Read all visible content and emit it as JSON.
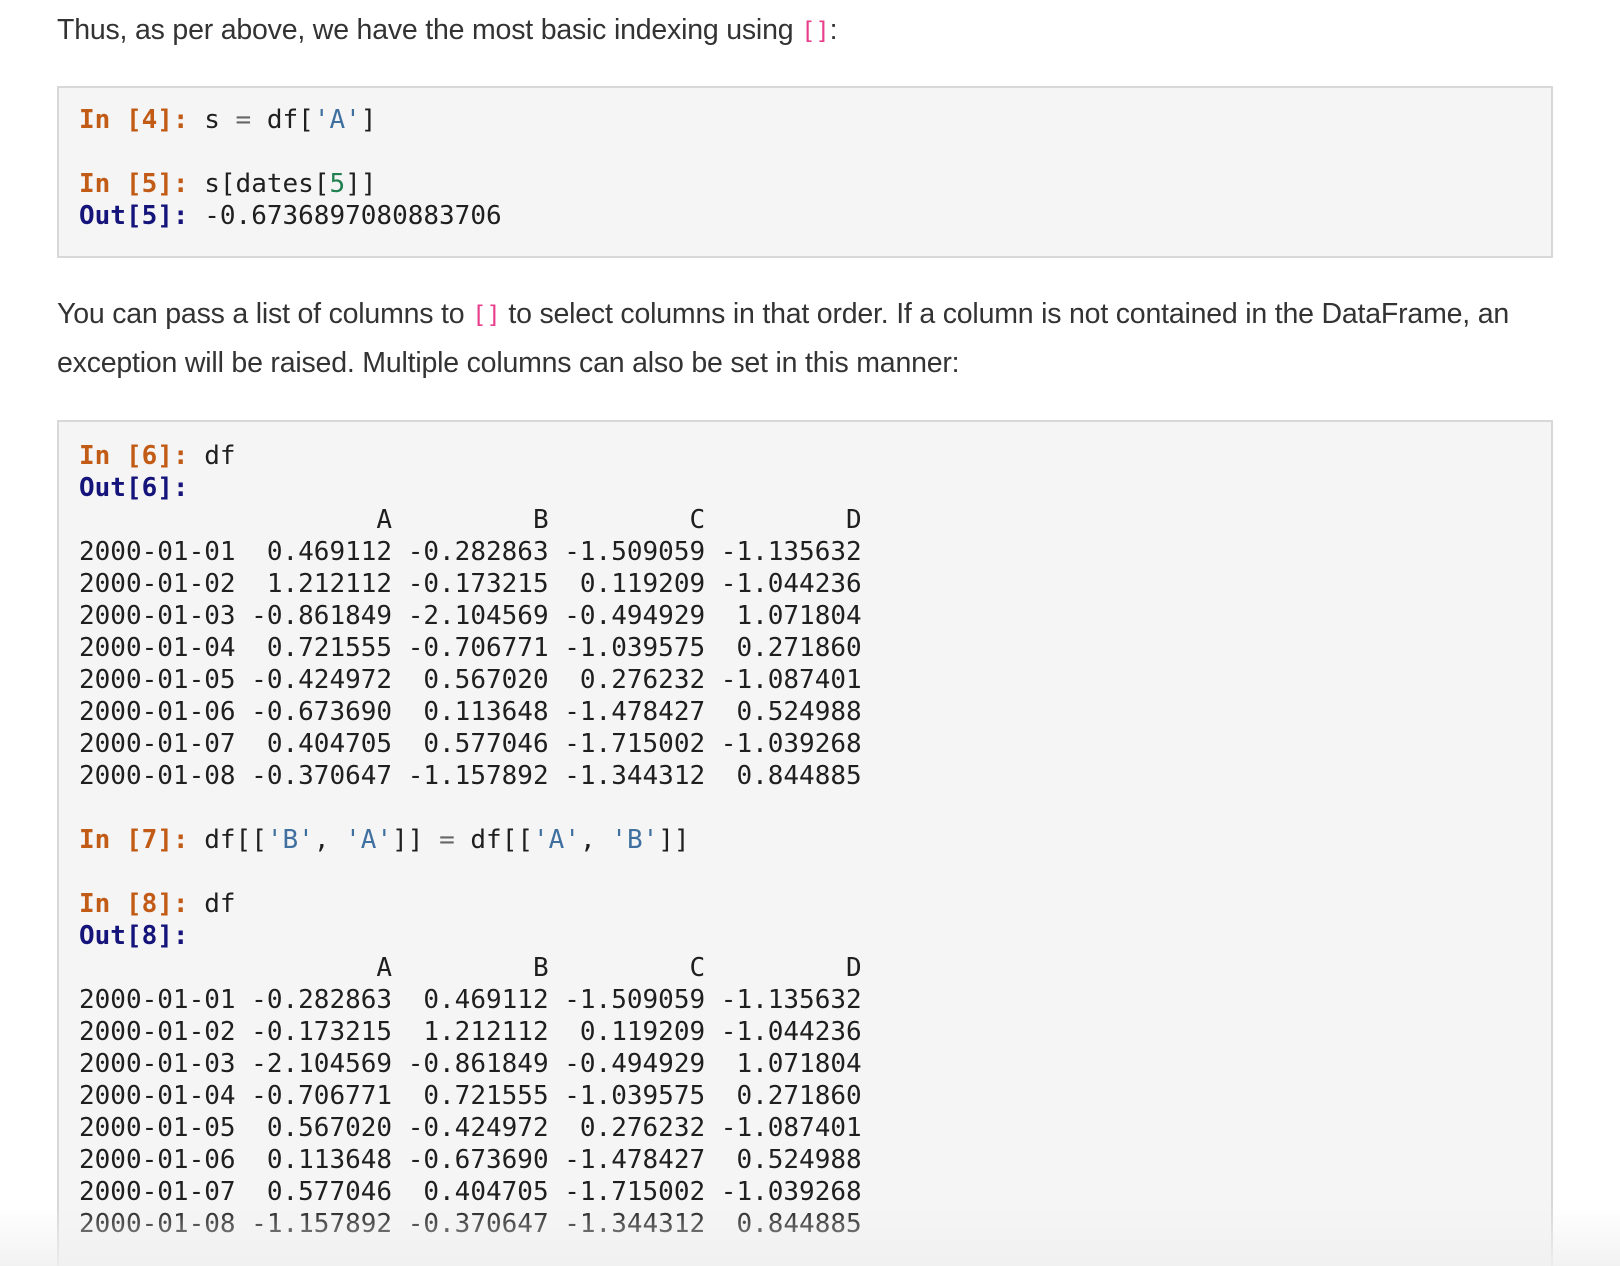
{
  "para1": {
    "text_before": "Thus, as per above, we have the most basic indexing using ",
    "code": "[]",
    "text_after": ":"
  },
  "block1": {
    "in4_prompt": "In [4]:",
    "in4_pre": " s ",
    "in4_op": "=",
    "in4_mid": " df[",
    "in4_str": "'A'",
    "in4_post": "]",
    "in5_prompt": "In [5]:",
    "in5_pre": " s[dates[",
    "in5_num": "5",
    "in5_post": "]]",
    "out5_prompt": "Out[5]:",
    "out5_value": " -0.6736897080883706"
  },
  "para2": {
    "text_before": "You can pass a list of columns to ",
    "code": "[]",
    "text_after": " to select columns in that order. If a column is not contained in the DataFrame, an exception will be raised. Multiple columns can also be set in this manner:"
  },
  "block2": {
    "in6_prompt": "In [6]:",
    "in6_code": " df",
    "out6_prompt": "Out[6]:",
    "table1": {
      "header": "                   A         B         C         D",
      "rows": [
        "2000-01-01  0.469112 -0.282863 -1.509059 -1.135632",
        "2000-01-02  1.212112 -0.173215  0.119209 -1.044236",
        "2000-01-03 -0.861849 -2.104569 -0.494929  1.071804",
        "2000-01-04  0.721555 -0.706771 -1.039575  0.271860",
        "2000-01-05 -0.424972  0.567020  0.276232 -1.087401",
        "2000-01-06 -0.673690  0.113648 -1.478427  0.524988",
        "2000-01-07  0.404705  0.577046 -1.715002 -1.039268",
        "2000-01-08 -0.370647 -1.157892 -1.344312  0.844885"
      ]
    },
    "in7_prompt": "In [7]:",
    "in7_a": " df[[",
    "in7_s1": "'B'",
    "in7_b": ", ",
    "in7_s2": "'A'",
    "in7_c": "]] ",
    "in7_op": "=",
    "in7_d": " df[[",
    "in7_s3": "'A'",
    "in7_e": ", ",
    "in7_s4": "'B'",
    "in7_f": "]]",
    "in8_prompt": "In [8]:",
    "in8_code": " df",
    "out8_prompt": "Out[8]:",
    "table2": {
      "header": "                   A         B         C         D",
      "rows": [
        "2000-01-01 -0.282863  0.469112 -1.509059 -1.135632",
        "2000-01-02 -0.173215  1.212112  0.119209 -1.044236",
        "2000-01-03 -2.104569 -0.861849 -0.494929  1.071804",
        "2000-01-04 -0.706771  0.721555 -1.039575  0.271860",
        "2000-01-05  0.567020 -0.424972  0.276232 -1.087401",
        "2000-01-06  0.113648 -0.673690 -1.478427  0.524988",
        "2000-01-07  0.577046  0.404705 -1.715002 -1.039268",
        "2000-01-08 -1.157892 -0.370647 -1.344312  0.844885"
      ]
    }
  }
}
